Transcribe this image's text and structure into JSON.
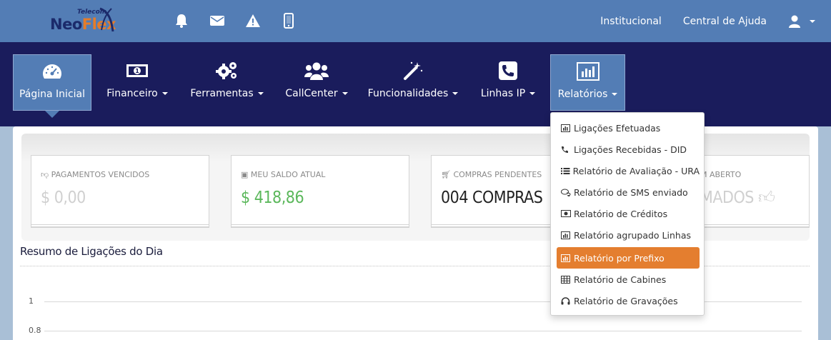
{
  "brand": {
    "logo_small": "Telecom",
    "logo_word_a": "Neo",
    "logo_word_b": "Flex"
  },
  "top_icons": [
    "bell-icon",
    "envelope-icon",
    "warning-icon",
    "mobile-icon"
  ],
  "toplinks": {
    "institucional": "Institucional",
    "ajuda": "Central de Ajuda"
  },
  "nav": {
    "home": "Página Inicial",
    "financeiro": "Financeiro",
    "ferramentas": "Ferramentas",
    "callcenter": "CallCenter",
    "funcionalidades": "Funcionalidades",
    "linhas": "Linhas IP",
    "relatorios": "Relatórios"
  },
  "cards": [
    {
      "title": "PAGAMENTOS VENCIDOS",
      "value": "$ 0,00",
      "color": "#d0d0d0"
    },
    {
      "title": "MEU SALDO ATUAL",
      "value": "$ 418,86",
      "color": "#5cb85c"
    },
    {
      "title": "COMPRAS PENDENTES",
      "value": "004 COMPRAS",
      "color": "#222222"
    },
    {
      "title": "M ABERTO",
      "value": "MADOS",
      "color": "#d0d0d0"
    }
  ],
  "section": {
    "title": "Resumo de Ligações do Dia"
  },
  "chart": {
    "y_ticks": [
      "1",
      "0.8"
    ]
  },
  "dropdown": [
    {
      "label": "Ligações Efetuadas",
      "icon": "bar-chart-icon"
    },
    {
      "label": "Ligações Recebidas - DID",
      "icon": "phone-icon"
    },
    {
      "label": "Relatório de Avaliação - URA",
      "icon": "list-icon"
    },
    {
      "label": "Relatório de SMS enviado",
      "icon": "comments-icon"
    },
    {
      "label": "Relatório de Créditos",
      "icon": "money-icon"
    },
    {
      "label": "Relatório agrupado Linhas",
      "icon": "bar-chart-icon"
    },
    {
      "label": "Relatório por Prefixo",
      "icon": "bar-chart-icon",
      "selected": true
    },
    {
      "label": "Relatório de Cabines",
      "icon": "table-icon"
    },
    {
      "label": "Relatório de Gravações",
      "icon": "headphones-icon"
    }
  ],
  "colors": {
    "topbar": "#537db5",
    "navbar": "#1a1c5c",
    "accent": "#e47e2f",
    "positive": "#5cb85c"
  }
}
